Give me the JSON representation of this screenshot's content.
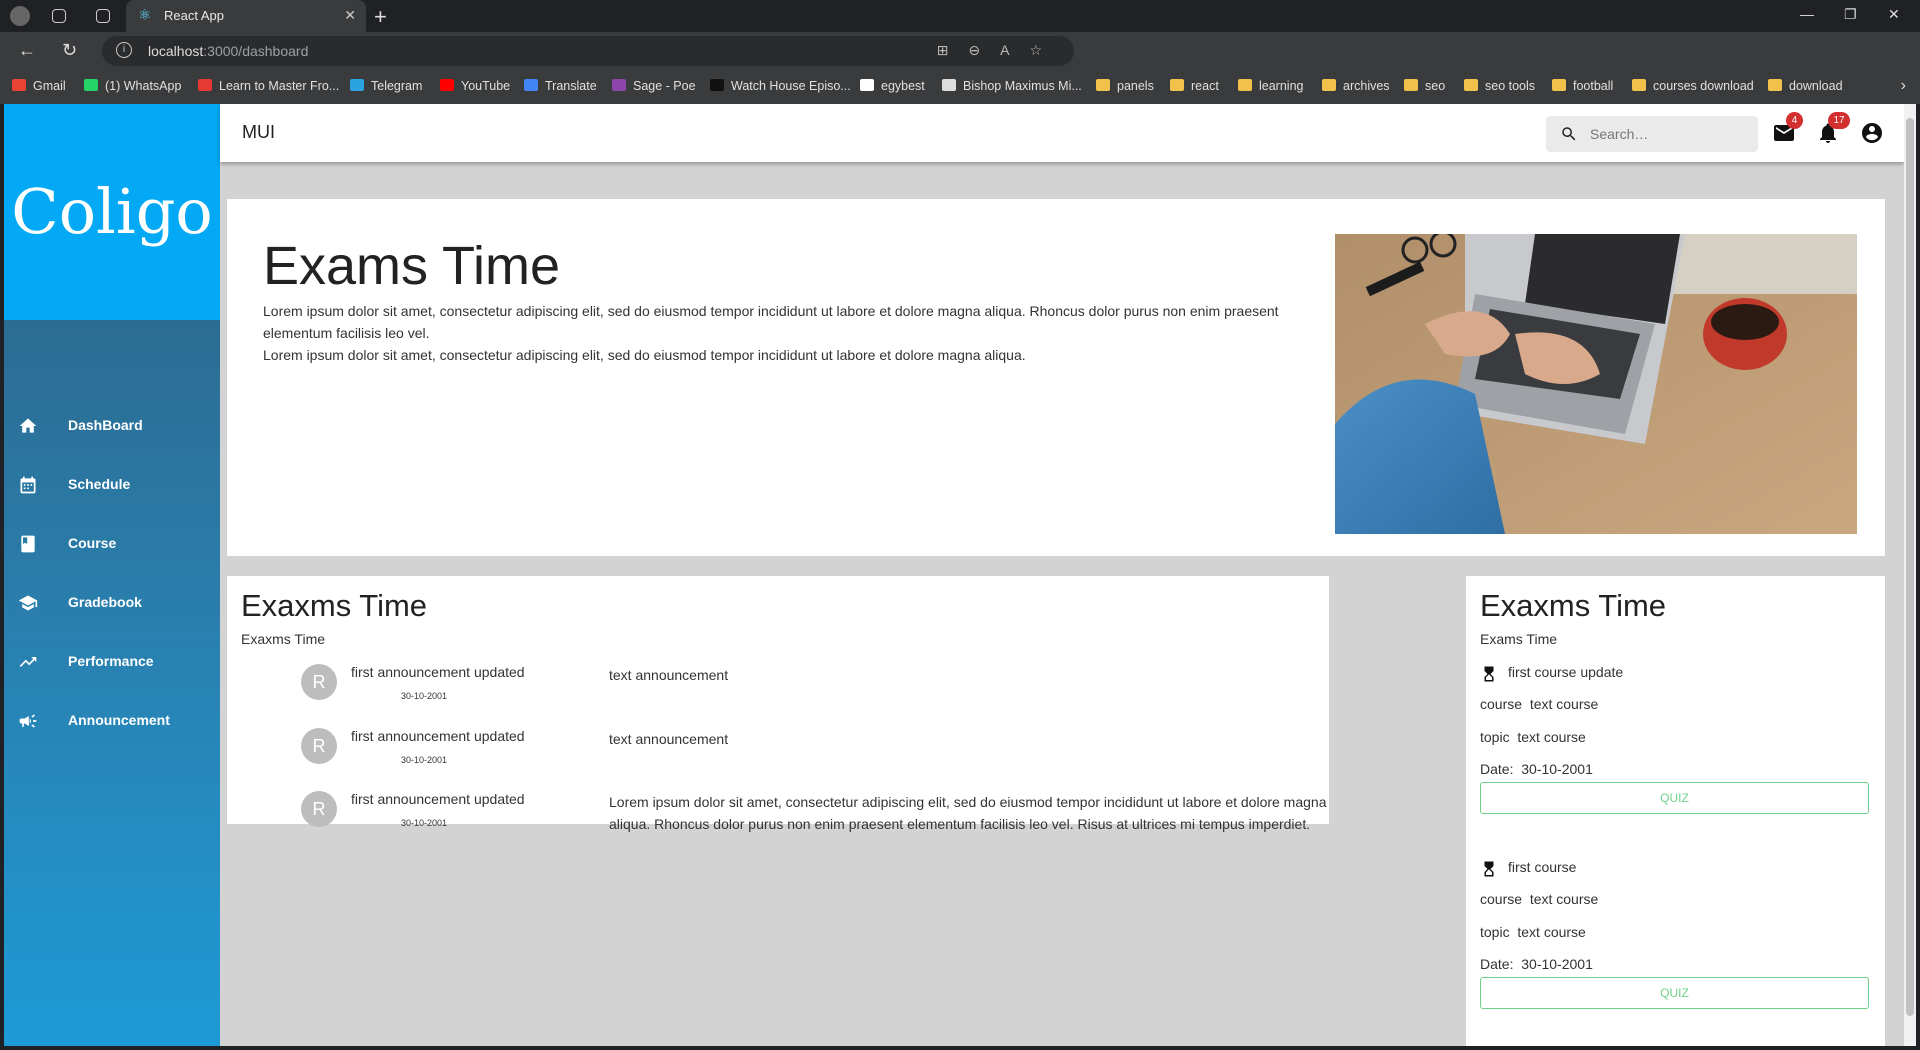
{
  "browser": {
    "tab_title": "React App",
    "url_host": "localhost",
    "url_path": ":3000/dashboard",
    "bookmarks": [
      {
        "label": "Gmail",
        "color": "#ea4335"
      },
      {
        "label": "(1) WhatsApp",
        "color": "#25d366"
      },
      {
        "label": "Learn to Master Fro...",
        "color": "#e53935"
      },
      {
        "label": "Telegram",
        "color": "#2aa3e0"
      },
      {
        "label": "YouTube",
        "color": "#ff0000"
      },
      {
        "label": "Translate",
        "color": "#4285f4"
      },
      {
        "label": "Sage - Poe",
        "color": "#8e44ad"
      },
      {
        "label": "Watch House Episo...",
        "color": "#111111"
      },
      {
        "label": "egybest",
        "color": "#ffffff"
      },
      {
        "label": "Bishop Maximus Mi...",
        "color": "#dddddd"
      },
      {
        "label": "panels",
        "color": "#f2c14b"
      },
      {
        "label": "react",
        "color": "#f2c14b"
      },
      {
        "label": "learning",
        "color": "#f2c14b"
      },
      {
        "label": "archives",
        "color": "#f2c14b"
      },
      {
        "label": "seo",
        "color": "#f2c14b"
      },
      {
        "label": "seo tools",
        "color": "#f2c14b"
      },
      {
        "label": "football",
        "color": "#f2c14b"
      },
      {
        "label": "courses download",
        "color": "#f2c14b"
      },
      {
        "label": "download",
        "color": "#f2c14b"
      }
    ]
  },
  "sidebar": {
    "logo": "Coligo",
    "items": [
      {
        "label": "DashBoard",
        "icon": "home-icon"
      },
      {
        "label": "Schedule",
        "icon": "calendar-icon"
      },
      {
        "label": "Course",
        "icon": "book-icon"
      },
      {
        "label": "Gradebook",
        "icon": "school-icon"
      },
      {
        "label": "Performance",
        "icon": "trending-up-icon"
      },
      {
        "label": "Announcement",
        "icon": "campaign-icon"
      }
    ]
  },
  "appbar": {
    "brand": "MUI",
    "search_placeholder": "Search…",
    "mail_count": "4",
    "notification_count": "17"
  },
  "hero": {
    "title": "Exams Time",
    "paragraph1": "Lorem ipsum dolor sit amet, consectetur adipiscing elit, sed do eiusmod tempor incididunt ut labore et dolore magna aliqua. Rhoncus dolor purus non enim praesent elementum facilisis leo vel.",
    "paragraph2": "Lorem ipsum dolor sit amet, consectetur adipiscing elit, sed do eiusmod tempor incididunt ut labore et dolore magna aliqua."
  },
  "announcements": {
    "title": "Exaxms Time",
    "subtitle": "Exaxms Time",
    "items": [
      {
        "avatar": "R",
        "title": "first announcement updated",
        "date": "30-10-2001",
        "text": "text announcement"
      },
      {
        "avatar": "R",
        "title": "first announcement updated",
        "date": "30-10-2001",
        "text": "text announcement"
      },
      {
        "avatar": "R",
        "title": "first announcement updated",
        "date": "30-10-2001",
        "text": "Lorem ipsum dolor sit amet, consectetur adipiscing elit, sed do eiusmod tempor incididunt ut labore et dolore magna aliqua. Rhoncus dolor purus non enim praesent elementum facilisis leo vel. Risus at ultrices mi tempus imperdiet."
      }
    ]
  },
  "due": {
    "title": "Exaxms Time",
    "subtitle": "Exams Time",
    "items": [
      {
        "title": "first course update",
        "course_label": "course",
        "course_value": "text course",
        "topic_label": "topic",
        "topic_value": "text course",
        "date_label": "Date:",
        "date_value": "30-10-2001",
        "button": "QUIZ"
      },
      {
        "title": "first course",
        "course_label": "course",
        "course_value": "text course",
        "topic_label": "topic",
        "topic_value": "text course",
        "date_label": "Date:",
        "date_value": "30-10-2001",
        "button": "QUIZ"
      }
    ]
  },
  "colors": {
    "logo_bg": "#03a9f4",
    "sidebar_top": "#2c5f7e",
    "sidebar_bottom": "#1e9ad6",
    "page_bg": "#d3d3d3",
    "quiz_green": "#6fd08a",
    "badge_red": "#d32f2f"
  }
}
